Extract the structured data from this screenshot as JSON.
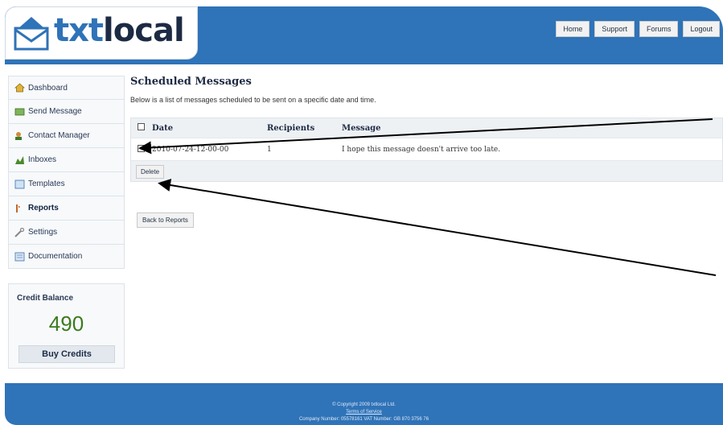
{
  "logo": {
    "part1": "txt",
    "part2": "local"
  },
  "topnav": [
    "Home",
    "Support",
    "Forums",
    "Logout"
  ],
  "sidebar": {
    "items": [
      {
        "label": "Dashboard",
        "icon": "house-icon"
      },
      {
        "label": "Send Message",
        "icon": "send-icon"
      },
      {
        "label": "Contact Manager",
        "icon": "contacts-icon"
      },
      {
        "label": "Inboxes",
        "icon": "inbox-icon"
      },
      {
        "label": "Templates",
        "icon": "template-icon"
      },
      {
        "label": "Reports",
        "icon": "reports-icon"
      },
      {
        "label": "Settings",
        "icon": "wrench-icon"
      },
      {
        "label": "Documentation",
        "icon": "document-icon"
      }
    ]
  },
  "credit": {
    "title": "Credit Balance",
    "value": "490",
    "buy": "Buy Credits"
  },
  "main": {
    "title": "Scheduled Messages",
    "intro": "Below is a list of messages scheduled to be sent on a specific date and time.",
    "columns": [
      "Date",
      "Recipients",
      "Message"
    ],
    "rows": [
      {
        "date": "2010-07-24-12-00-00",
        "recipients": "1",
        "message": "I hope this message doesn't arrive too late."
      }
    ],
    "delete_label": "Delete",
    "back_label": "Back to Reports"
  },
  "footer": {
    "copyright": "© Copyright 2009 txtlocal Ltd.",
    "terms": "Terms of Service",
    "company": "Company Number: 05578161  VAT Number: GB 870 3756 76"
  },
  "colors": {
    "brand_blue": "#2f73b8",
    "credit_green": "#3c7a1e"
  }
}
